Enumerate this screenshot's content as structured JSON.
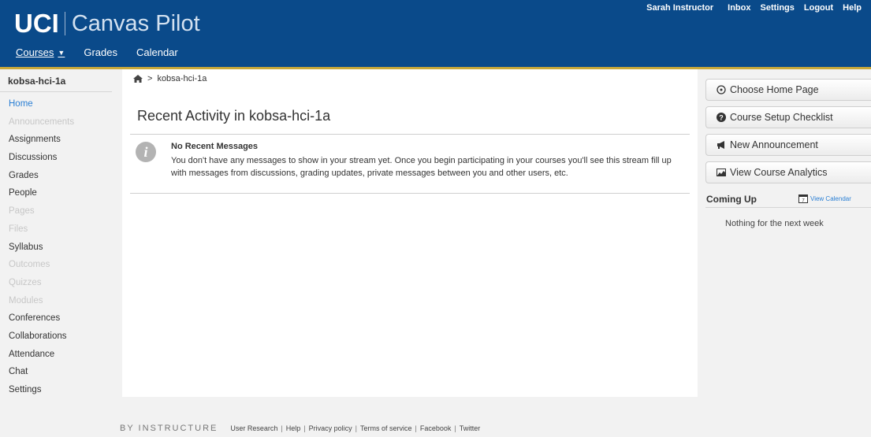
{
  "header": {
    "logo_text": "UCI",
    "app_name": "Canvas Pilot",
    "nav": [
      {
        "label": "Courses"
      },
      {
        "label": "Grades"
      },
      {
        "label": "Calendar"
      }
    ],
    "user_nav": [
      "Sarah Instructor",
      "Inbox",
      "Settings",
      "Logout",
      "Help"
    ],
    "bg_color": "#0a4a8a",
    "accent_color": "#c9a93a"
  },
  "sidebar": {
    "course_name": "kobsa-hci-1a",
    "items": [
      {
        "label": "Home",
        "state": "active"
      },
      {
        "label": "Announcements",
        "state": "disabled"
      },
      {
        "label": "Assignments",
        "state": "enabled"
      },
      {
        "label": "Discussions",
        "state": "enabled"
      },
      {
        "label": "Grades",
        "state": "enabled"
      },
      {
        "label": "People",
        "state": "enabled"
      },
      {
        "label": "Pages",
        "state": "disabled"
      },
      {
        "label": "Files",
        "state": "disabled"
      },
      {
        "label": "Syllabus",
        "state": "enabled"
      },
      {
        "label": "Outcomes",
        "state": "disabled"
      },
      {
        "label": "Quizzes",
        "state": "disabled"
      },
      {
        "label": "Modules",
        "state": "disabled"
      },
      {
        "label": "Conferences",
        "state": "enabled"
      },
      {
        "label": "Collaborations",
        "state": "enabled"
      },
      {
        "label": "Attendance",
        "state": "enabled"
      },
      {
        "label": "Chat",
        "state": "enabled"
      },
      {
        "label": "Settings",
        "state": "enabled"
      }
    ]
  },
  "breadcrumb": {
    "home_icon": "home-icon",
    "separator": ">",
    "current": "kobsa-hci-1a"
  },
  "main": {
    "title": "Recent Activity in kobsa-hci-1a",
    "message_title": "No Recent Messages",
    "message_body": "You don't have any messages to show in your stream yet. Once you begin participating in your courses you'll see this stream fill up with messages from discussions, grading updates, private messages between you and other users, etc.",
    "info_icon": "info-icon"
  },
  "right_sidebar": {
    "buttons": [
      {
        "label": "Choose Home Page",
        "icon": "target-icon"
      },
      {
        "label": "Course Setup Checklist",
        "icon": "question-icon"
      },
      {
        "label": "New Announcement",
        "icon": "megaphone-icon"
      },
      {
        "label": "View Course Analytics",
        "icon": "analytics-icon"
      }
    ],
    "coming_up_title": "Coming Up",
    "view_calendar_label": "View Calendar",
    "nothing_text": "Nothing for the next week"
  },
  "footer": {
    "brand": "BY INSTRUCTURE",
    "links": [
      "User Research",
      "Help",
      "Privacy policy",
      "Terms of service",
      "Facebook",
      "Twitter"
    ]
  }
}
